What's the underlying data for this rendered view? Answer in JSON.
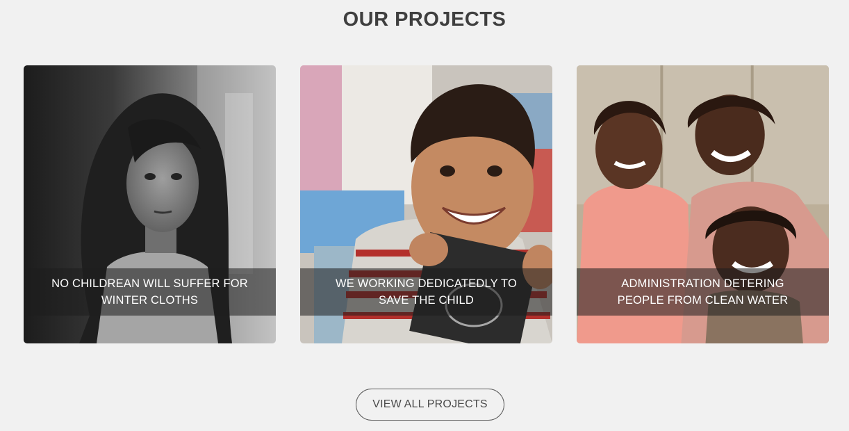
{
  "section": {
    "title": "OUR PROJECTS"
  },
  "projects": [
    {
      "caption": "NO CHILDREAN WILL SUFFER FOR WINTER CLOTHS",
      "photo": "girl-portrait-bw"
    },
    {
      "caption": "WE WORKING DEDICATEDLY TO SAVE THE CHILD",
      "photo": "smiling-boy-with-slate"
    },
    {
      "caption": "ADMINISTRATION DETERING PEOPLE FROM CLEAN WATER",
      "photo": "three-smiling-girls"
    }
  ],
  "actions": {
    "view_all_label": "VIEW ALL PROJECTS"
  },
  "colors": {
    "background": "#f1f1f1",
    "title": "#3f3f3f",
    "caption_overlay": "rgba(30,30,30,0.55)",
    "button_border": "#5a5a5a"
  }
}
